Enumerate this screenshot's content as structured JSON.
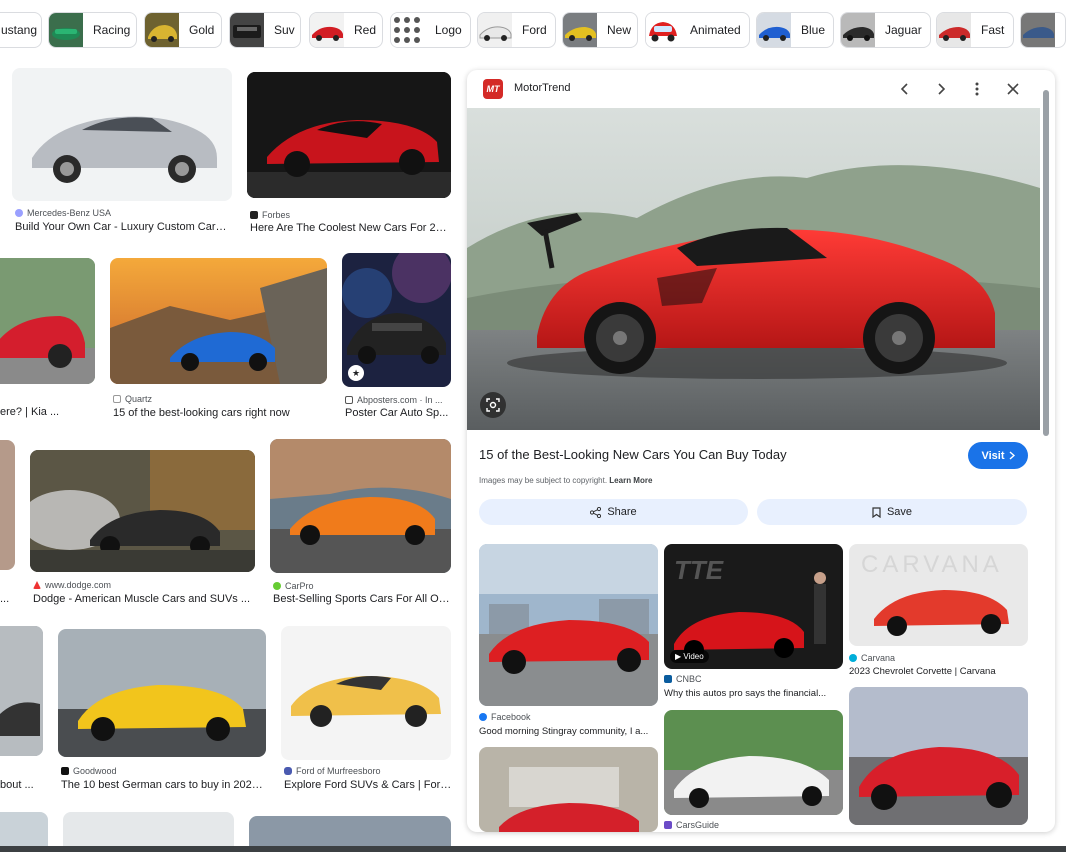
{
  "chips": [
    {
      "label": "ustang"
    },
    {
      "label": "Racing"
    },
    {
      "label": "Gold"
    },
    {
      "label": "Suv"
    },
    {
      "label": "Red"
    },
    {
      "label": "Logo"
    },
    {
      "label": "Ford"
    },
    {
      "label": "New"
    },
    {
      "label": "Animated"
    },
    {
      "label": "Blue"
    },
    {
      "label": "Jaguar"
    },
    {
      "label": "Fast"
    }
  ],
  "results": [
    {
      "source": "Mercedes-Benz USA",
      "title": "Build Your Own Car - Luxury Custom Cars ..."
    },
    {
      "source": "Forbes",
      "title": "Here Are The Coolest New Cars For 2020"
    },
    {
      "source": "",
      "title": "ere? | Kia ..."
    },
    {
      "source": "Quartz",
      "title": "15 of the best-looking cars right now"
    },
    {
      "source": "Abposters.com · In ...",
      "title": "Poster Car Auto Sp..."
    },
    {
      "source": "",
      "title": "..."
    },
    {
      "source": "www.dodge.com",
      "title": "Dodge - American Muscle Cars and SUVs ..."
    },
    {
      "source": "CarPro",
      "title": "Best-Selling Sports Cars For All Of ..."
    },
    {
      "source": "",
      "title": "bout ..."
    },
    {
      "source": "Goodwood",
      "title": "The 10 best German cars to buy in 2025 ..."
    },
    {
      "source": "Ford of Murfreesboro",
      "title": "Explore Ford SUVs & Cars | Ford ..."
    }
  ],
  "panel": {
    "site": "MotorTrend",
    "logo_text": "MT",
    "title": "15 of the Best-Looking New Cars You Can Buy Today",
    "visit_label": "Visit",
    "copyright_text": "Images may be subject to copyright.",
    "learn_more": "Learn More",
    "share_label": "Share",
    "save_label": "Save",
    "related": [
      {
        "source": "Facebook",
        "title": "Good morning Stingray community, I a..."
      },
      {
        "source": "CNBC",
        "title": "Why this autos pro says the financial...",
        "badge": "Video"
      },
      {
        "source": "Carvana",
        "title": "2023 Chevrolet Corvette | Carvana",
        "watermark": "CARVANA"
      },
      {
        "source": "",
        "title": ""
      },
      {
        "source": "CarsGuide",
        "title": ""
      },
      {
        "source": "",
        "title": ""
      }
    ]
  },
  "colors": {
    "accent": "#1a73e8",
    "motortrend_red": "#d42a27",
    "pill_bg": "#e8f0fe"
  }
}
